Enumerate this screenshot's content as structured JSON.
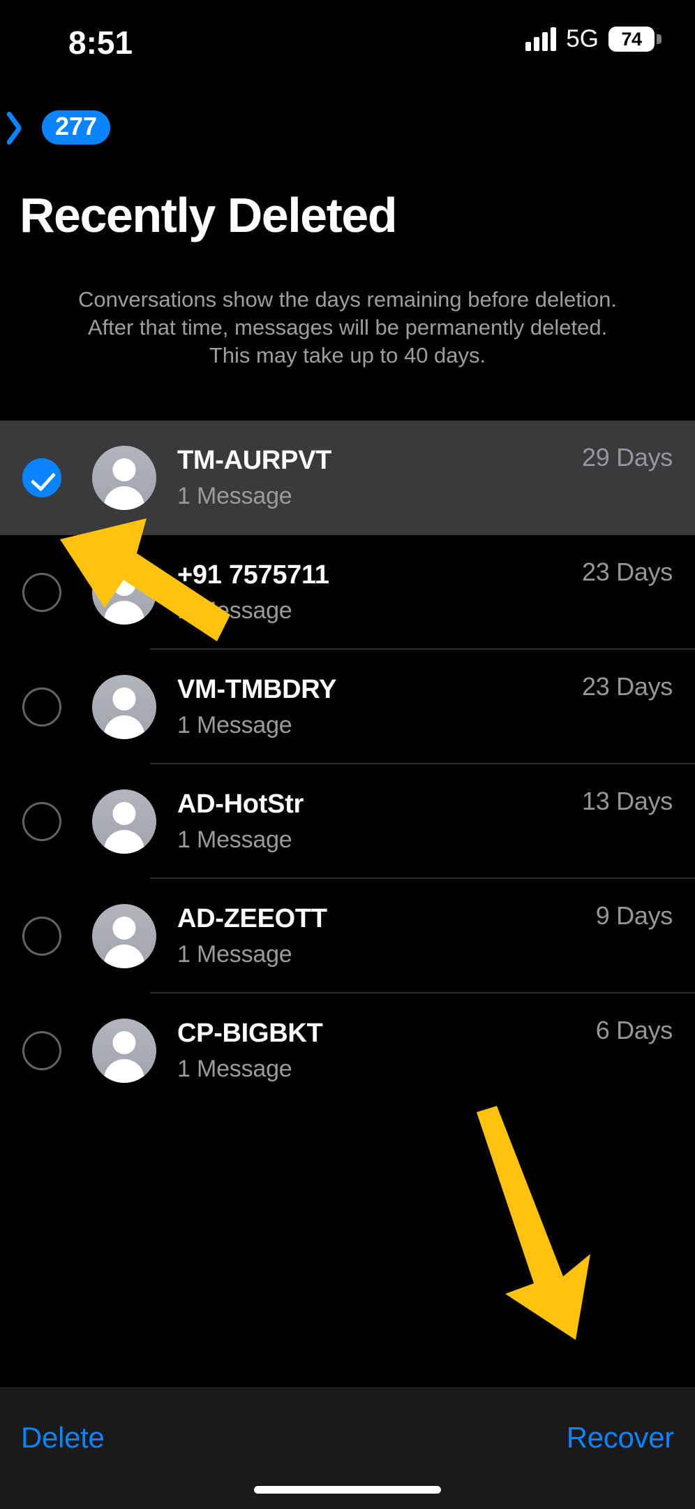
{
  "status_bar": {
    "time": "8:51",
    "network": "5G",
    "battery_percent": "74",
    "signal_icon": "cellular-bars-icon",
    "battery_icon": "battery-icon"
  },
  "nav": {
    "back_icon": "chevron-left-icon",
    "back_badge": "277"
  },
  "header": {
    "title": "Recently Deleted",
    "description_line1": "Conversations show the days remaining before deletion.",
    "description_line2": "After that time, messages will be permanently deleted.",
    "description_line3": "This may take up to 40 days."
  },
  "colors": {
    "accent_blue": "#0a84ff",
    "selected_row": "#3a3a3c",
    "annotation_yellow": "#ffc20e",
    "background": "#000000",
    "secondary_text": "#9b9b9e"
  },
  "conversations": [
    {
      "name": "TM-AURPVT",
      "messages": "1 Message",
      "days": "29 Days",
      "selected": true
    },
    {
      "name": "+91 7575711",
      "messages": "1 Message",
      "days": "23 Days",
      "selected": false
    },
    {
      "name": "VM-TMBDRY",
      "messages": "1 Message",
      "days": "23 Days",
      "selected": false
    },
    {
      "name": "AD-HotStr",
      "messages": "1 Message",
      "days": "13 Days",
      "selected": false
    },
    {
      "name": "AD-ZEEOTT",
      "messages": "1 Message",
      "days": "9 Days",
      "selected": false
    },
    {
      "name": "CP-BIGBKT",
      "messages": "1 Message",
      "days": "6 Days",
      "selected": false
    }
  ],
  "toolbar": {
    "delete_label": "Delete",
    "recover_label": "Recover"
  },
  "annotations": [
    {
      "id": "arrow-to-checkbox",
      "points_to": "selection-checkbox-row-1"
    },
    {
      "id": "arrow-to-recover",
      "points_to": "recover-button"
    }
  ]
}
